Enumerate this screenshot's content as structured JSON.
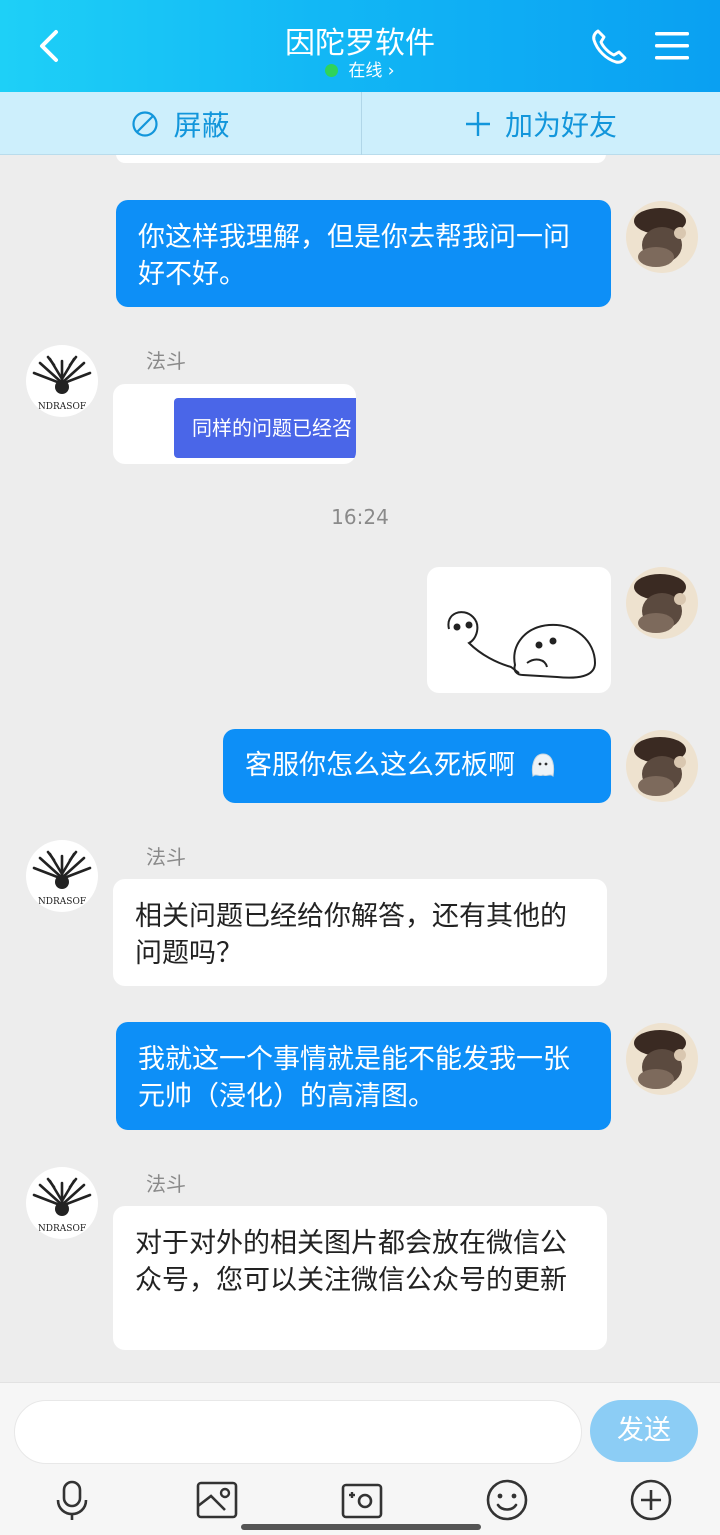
{
  "header": {
    "title": "因陀罗软件",
    "status": "在线 ›"
  },
  "actions": {
    "block": "屏蔽",
    "add_friend": "加为好友"
  },
  "messages": {
    "m1": "你这样我理解，但是你去帮我问一问好不好。",
    "m2_sender": "法斗",
    "m2_image_text": "同样的问题已经咨",
    "time": "16:24",
    "m4": "客服你怎么这么死板啊",
    "m5_sender": "法斗",
    "m5": "相关问题已经给你解答，还有其他的问题吗？",
    "m6": "我就这一个事情就是能不能发我一张元帅（浸化）的高清图。",
    "m7_sender": "法斗",
    "m7": "对于对外的相关图片都会放在微信公众号，您可以关注微信公众号的更新"
  },
  "peer_avatar_text": "NDRASOF",
  "input": {
    "send": "发送"
  },
  "colors": {
    "header_start": "#1ed0f7",
    "header_end": "#0aa0f2",
    "outgoing_bubble": "#0d8ff7",
    "online_dot": "#2fd35b"
  }
}
